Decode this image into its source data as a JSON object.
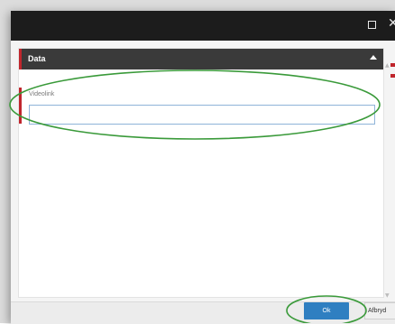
{
  "dialog": {
    "maximize_icon": "maximize-icon",
    "close_icon": "close-icon"
  },
  "section": {
    "title": "Data",
    "toggle_icon": "chevron-up-icon"
  },
  "field": {
    "label": "Videolink",
    "value": "",
    "placeholder": ""
  },
  "footer": {
    "ok_label": "Ok",
    "cancel_label": "Afbryd"
  },
  "colors": {
    "titlebar": "#1c1c1c",
    "section_header": "#3a3a3a",
    "accent_red": "#c0262d",
    "primary_button": "#2f7fc1",
    "annotation_green": "#3a9a3a"
  }
}
